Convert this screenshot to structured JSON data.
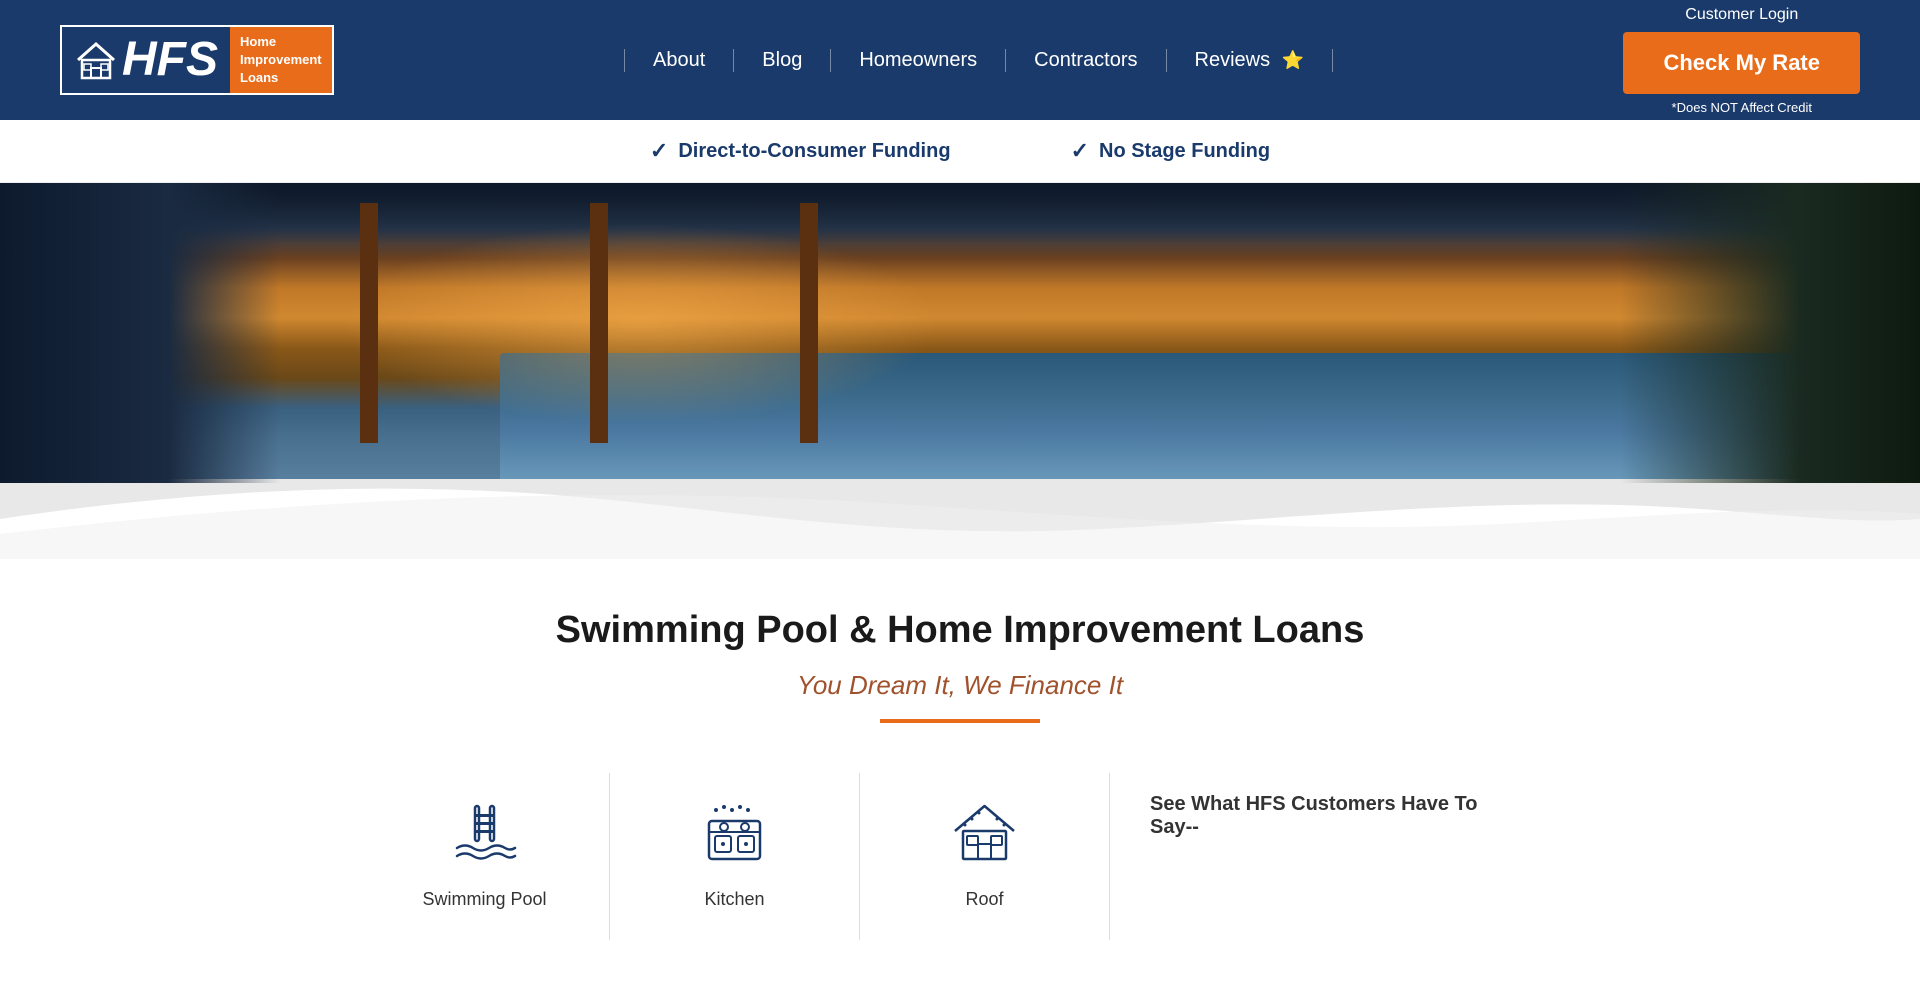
{
  "header": {
    "logo": {
      "letters": "HFS",
      "line1": "Home",
      "line2": "Improvement",
      "line3": "Loans"
    },
    "customer_login": "Customer Login",
    "cta_button": "Check My Rate",
    "cta_sub": "*Does NOT Affect Credit"
  },
  "nav": {
    "items": [
      {
        "label": "About",
        "id": "about"
      },
      {
        "label": "Blog",
        "id": "blog"
      },
      {
        "label": "Homeowners",
        "id": "homeowners"
      },
      {
        "label": "Contractors",
        "id": "contractors"
      },
      {
        "label": "Reviews ⭐",
        "id": "reviews"
      }
    ]
  },
  "banner": {
    "items": [
      {
        "text": "Direct-to-Consumer Funding"
      },
      {
        "text": "No Stage Funding"
      }
    ]
  },
  "hero": {
    "alt": "Swimming pool and home exterior at dusk"
  },
  "main": {
    "title": "Swimming Pool & Home Improvement Loans",
    "tagline": "You Dream It, We Finance It",
    "icons": [
      {
        "label": "Swimming Pool",
        "icon": "pool-icon"
      },
      {
        "label": "Kitchen",
        "icon": "kitchen-icon"
      },
      {
        "label": "Roof",
        "icon": "roof-icon"
      }
    ],
    "customers_say": "See What HFS Customers Have To Say--"
  }
}
